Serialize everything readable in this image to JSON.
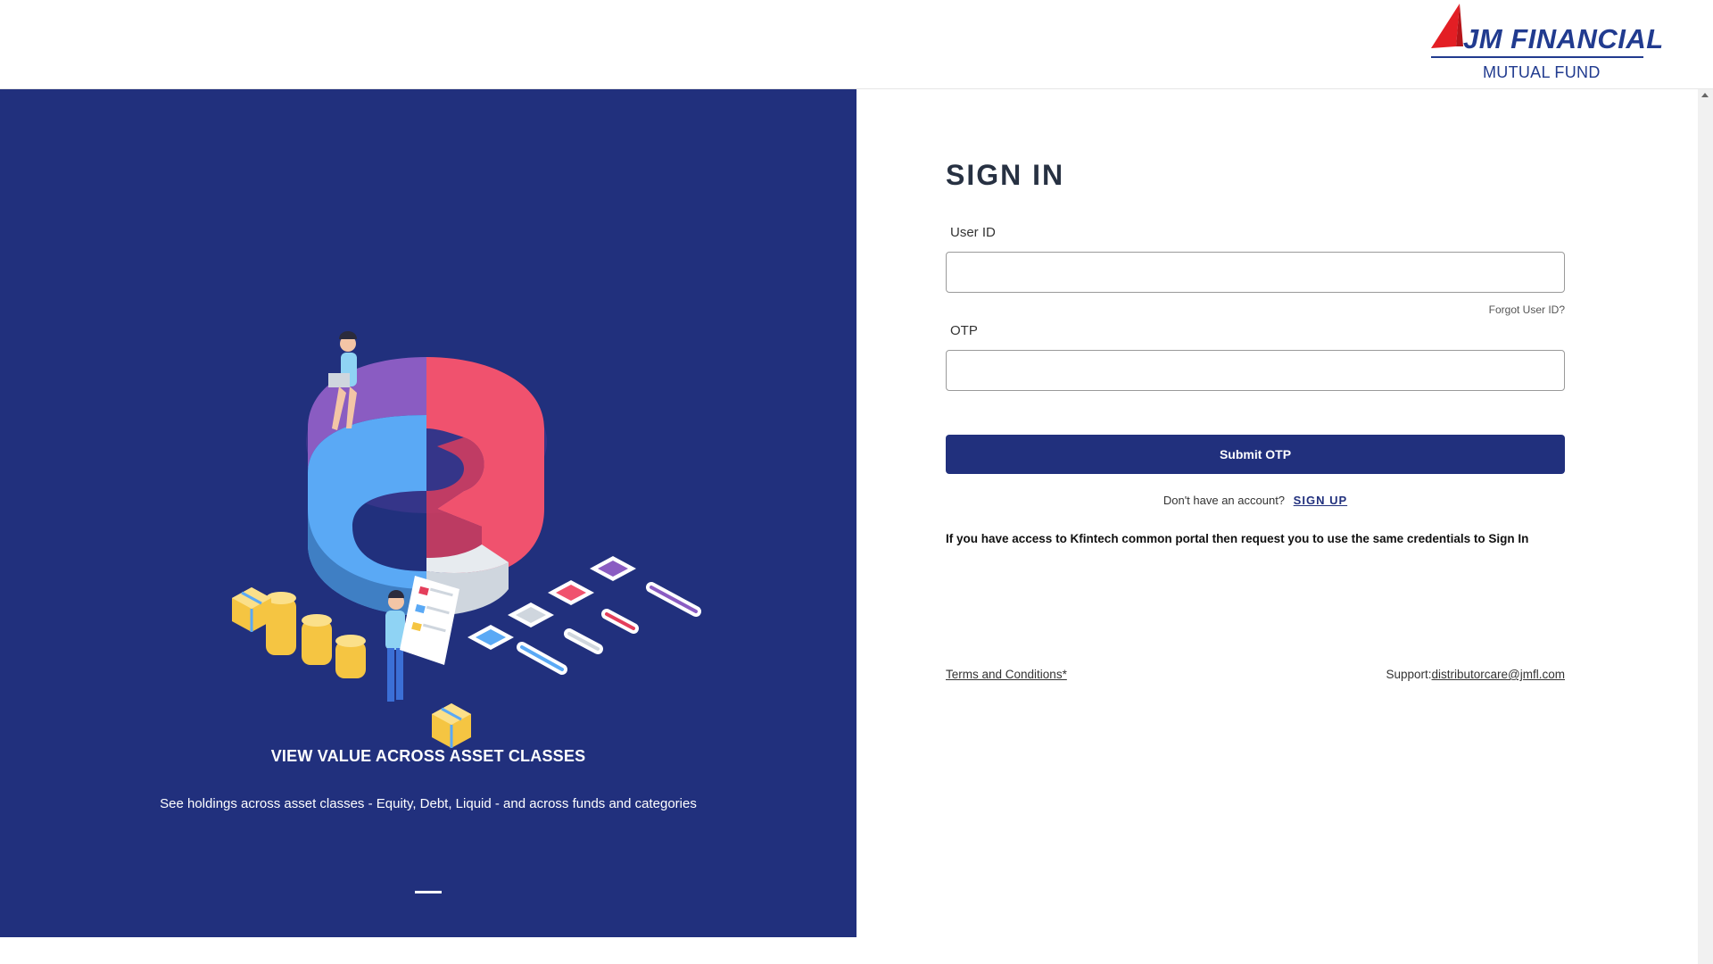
{
  "brand": {
    "logo_title": "JM FINANCIAL",
    "logo_subtitle": "MUTUAL FUND",
    "primary_color": "#21307d",
    "accent_red": "#e31e24"
  },
  "carousel": {
    "slide_title": "VIEW VALUE ACROSS ASSET CLASSES",
    "slide_description": "See holdings across asset classes - Equity, Debt, Liquid - and across funds and categories"
  },
  "signin": {
    "heading": "SIGN IN",
    "userid_label": "User ID",
    "userid_value": "",
    "forgot_userid": "Forgot User ID?",
    "otp_label": "OTP",
    "otp_value": "",
    "submit_label": "Submit OTP",
    "no_account_text": "Don't have an account?",
    "signup_label": "SIGN UP",
    "kfintech_notice": "If you have access to Kfintech common portal then request you to use the same credentials to Sign In",
    "terms_label": "Terms and Conditions*",
    "support_prefix": "Support:",
    "support_email": "distributorcare@jmfl.com"
  }
}
